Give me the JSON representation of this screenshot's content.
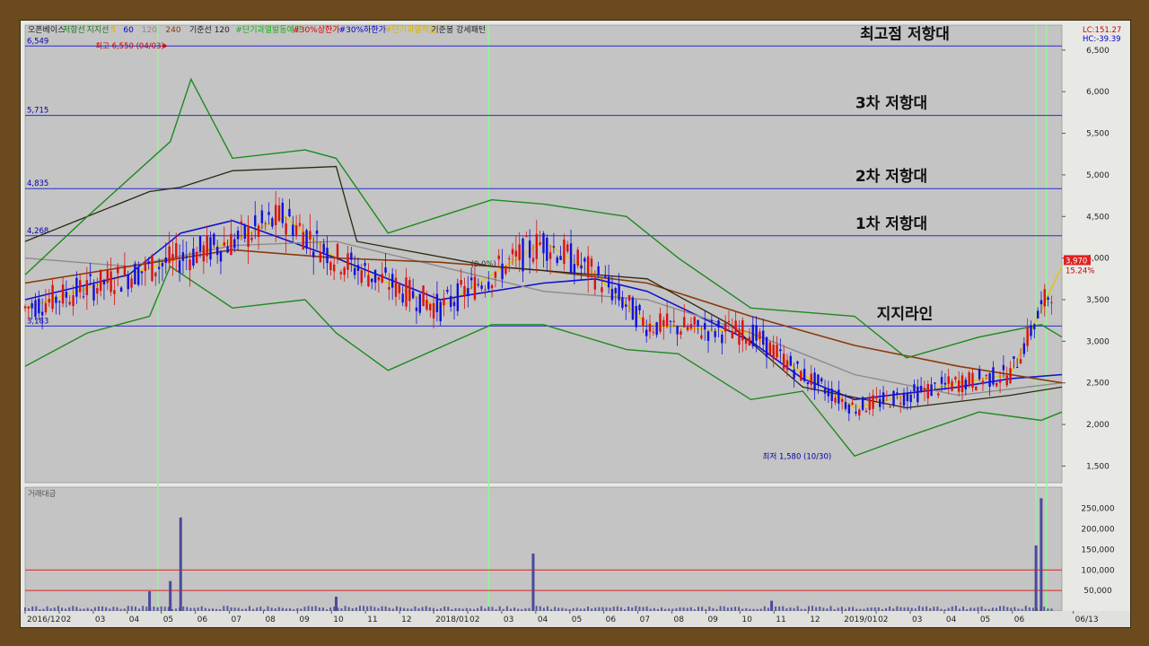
{
  "chart_data": [
    {
      "type": "candlestick",
      "legend": [
        {
          "label": "오픈베이스",
          "color": "#222222"
        },
        {
          "label": "저항선",
          "color": "#1a7a1a"
        },
        {
          "label": "지지선",
          "color": "#1a7a1a"
        },
        {
          "label": "5",
          "color": "#d8b400"
        },
        {
          "label": "60",
          "color": "#0000cc"
        },
        {
          "label": "120",
          "color": "#888888"
        },
        {
          "label": "240",
          "color": "#8b3a0a"
        },
        {
          "label": "기준선 120",
          "color": "#222222"
        },
        {
          "label": "#단기과열발동예고",
          "color": "#22aa22"
        },
        {
          "label": "#30%상한가",
          "color": "#cc0000"
        },
        {
          "label": "#30%하한가",
          "color": "#0000cc"
        },
        {
          "label": "#단기과열적출",
          "color": "#d8b400"
        },
        {
          "label": "기준봉 강세패턴",
          "color": "#222222"
        }
      ],
      "lc_label": "LC:151.27",
      "hc_label": "HC:-39.39",
      "y_ticks": [
        "6,500",
        "6,000",
        "5,500",
        "5,000",
        "4,500",
        "4,000",
        "3,500",
        "3,000",
        "2,500",
        "2,000",
        "1,500"
      ],
      "ylim": [
        1300,
        6800
      ],
      "x_ticks": [
        "2016/12",
        "02",
        "03",
        "04",
        "05",
        "06",
        "07",
        "08",
        "09",
        "10",
        "11",
        "12",
        "2018/01",
        "02",
        "03",
        "04",
        "05",
        "06",
        "07",
        "08",
        "09",
        "10",
        "11",
        "12",
        "2019/01",
        "02",
        "03",
        "04",
        "05",
        "06",
        "06/13"
      ],
      "levels": [
        {
          "label": "6,549",
          "value": 6549
        },
        {
          "label": "5,715",
          "value": 5715
        },
        {
          "label": "4,835",
          "value": 4835
        },
        {
          "label": "4,268",
          "value": 4268
        },
        {
          "label": "3,183",
          "value": 3183
        }
      ],
      "annotations": [
        "최고점 저항대",
        "3차 저항대",
        "2차 저항대",
        "1차 저항대",
        "지지라인"
      ],
      "high_label": "최고 6,550 (04/03)",
      "low_label": "최저 1,580 (10/30)",
      "mid_label": "(0.0%)",
      "last_price": "3,970",
      "last_change": "15.24%",
      "series": [
        {
          "name": "5",
          "x": [
            0,
            0.1,
            0.2,
            0.25,
            0.3,
            0.4,
            0.5,
            0.55,
            0.6,
            0.7,
            0.75,
            0.8,
            0.9,
            0.95,
            1.0
          ],
          "values": [
            3400,
            3800,
            4200,
            4500,
            4000,
            3400,
            4200,
            3800,
            3200,
            3100,
            2600,
            2200,
            2500,
            2600,
            3900
          ]
        },
        {
          "name": "60",
          "x": [
            0,
            0.1,
            0.15,
            0.2,
            0.3,
            0.4,
            0.5,
            0.55,
            0.6,
            0.7,
            0.75,
            0.8,
            0.9,
            0.95,
            1.0
          ],
          "values": [
            3500,
            3800,
            4300,
            4450,
            4000,
            3500,
            3700,
            3750,
            3600,
            3000,
            2550,
            2300,
            2450,
            2550,
            2600
          ]
        },
        {
          "name": "120",
          "x": [
            0,
            0.1,
            0.2,
            0.3,
            0.4,
            0.5,
            0.6,
            0.7,
            0.8,
            0.9,
            1.0
          ],
          "values": [
            4000,
            3900,
            4150,
            4200,
            3900,
            3600,
            3500,
            3100,
            2600,
            2350,
            2500
          ]
        },
        {
          "name": "240",
          "x": [
            0,
            0.1,
            0.2,
            0.3,
            0.4,
            0.5,
            0.6,
            0.7,
            0.8,
            0.9,
            1.0
          ],
          "values": [
            3700,
            3900,
            4100,
            4000,
            3950,
            3850,
            3700,
            3300,
            2950,
            2700,
            2500
          ]
        },
        {
          "name": "기준선 120",
          "x": [
            0,
            0.12,
            0.15,
            0.2,
            0.3,
            0.32,
            0.45,
            0.6,
            0.68,
            0.75,
            0.85,
            0.95,
            1.0
          ],
          "values": [
            4200,
            4800,
            4850,
            5050,
            5100,
            4200,
            3900,
            3750,
            3200,
            2450,
            2200,
            2350,
            2450
          ]
        },
        {
          "name": "저항선",
          "x": [
            0,
            0.06,
            0.14,
            0.16,
            0.2,
            0.27,
            0.3,
            0.35,
            0.45,
            0.5,
            0.58,
            0.63,
            0.7,
            0.8,
            0.85,
            0.92,
            0.98,
            1.0
          ],
          "values": [
            3800,
            4500,
            5400,
            6150,
            5200,
            5300,
            5200,
            4300,
            4700,
            4650,
            4500,
            4000,
            3400,
            3300,
            2800,
            3050,
            3200,
            3050
          ]
        },
        {
          "name": "지지선",
          "x": [
            0,
            0.06,
            0.12,
            0.14,
            0.2,
            0.27,
            0.3,
            0.35,
            0.45,
            0.5,
            0.58,
            0.63,
            0.7,
            0.75,
            0.8,
            0.85,
            0.92,
            0.98,
            1.0
          ],
          "values": [
            2700,
            3100,
            3300,
            3900,
            3400,
            3500,
            3100,
            2650,
            3200,
            3200,
            2900,
            2850,
            2300,
            2400,
            1620,
            1850,
            2150,
            2050,
            2150
          ]
        }
      ]
    },
    {
      "type": "bar",
      "title": "거래대금",
      "y_ticks": [
        "250,000",
        "200,000",
        "150,000",
        "100,000",
        "50,000"
      ],
      "ylim": [
        0,
        280000
      ],
      "ref_levels": [
        100000,
        50000
      ],
      "spikes": [
        {
          "x": 0.12,
          "value": 48000
        },
        {
          "x": 0.14,
          "value": 73000
        },
        {
          "x": 0.15,
          "value": 228000
        },
        {
          "x": 0.3,
          "value": 35000
        },
        {
          "x": 0.49,
          "value": 140000
        },
        {
          "x": 0.72,
          "value": 25000
        },
        {
          "x": 0.975,
          "value": 160000
        },
        {
          "x": 0.98,
          "value": 275000
        }
      ]
    }
  ]
}
